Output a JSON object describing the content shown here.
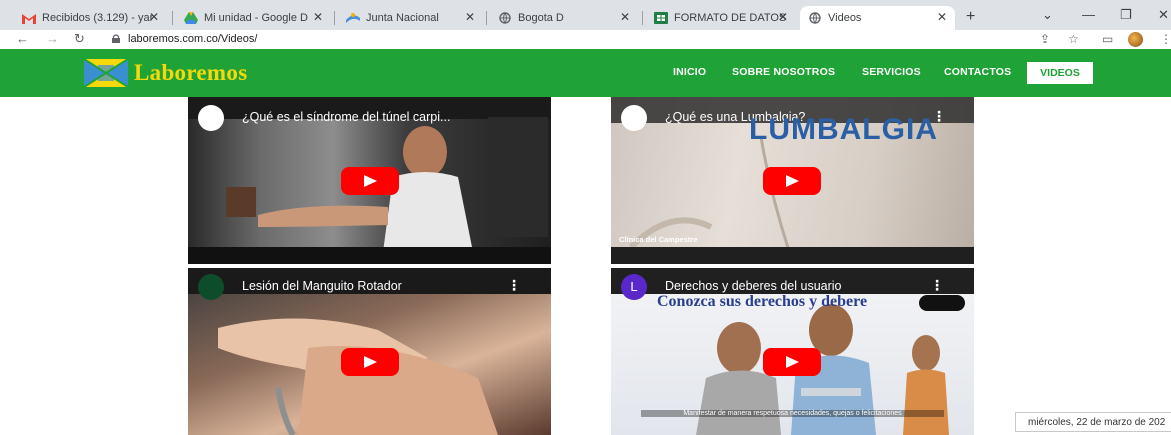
{
  "browser": {
    "tabs": [
      {
        "title": "Recibidos (3.129) - yar",
        "icon": "gmail-icon"
      },
      {
        "title": "Mi unidad - Google D",
        "icon": "drive-icon"
      },
      {
        "title": "Junta Nacional",
        "icon": "site-icon"
      },
      {
        "title": "Bogota D",
        "icon": "globe-icon"
      },
      {
        "title": "FORMATO DE DATOS",
        "icon": "sheets-icon"
      },
      {
        "title": "Videos",
        "icon": "globe-icon"
      }
    ],
    "url": "laboremos.com.co/Videos/"
  },
  "site": {
    "logo_text": "Laboremos",
    "nav": {
      "inicio": "INICIO",
      "sobre": "SOBRE NOSOTROS",
      "servicios": "SERVICIOS",
      "contactos": "CONTACTOS",
      "videos": "VIDEOS"
    },
    "colors": {
      "header": "#1fa336",
      "logo": "#f5d90a",
      "play": "#ff0000"
    }
  },
  "videos": [
    {
      "title": "¿Qué es el síndrome del túnel carpi..."
    },
    {
      "title": "¿Qué es una Lumbalgia?",
      "overlay": "LUMBALGIA",
      "caption": "Clínica del Campestre"
    },
    {
      "title": "Lesión del Manguito Rotador"
    },
    {
      "title": "Derechos y deberes del usuario",
      "overlay": "Conozca sus derechos y debere",
      "caption": "Manifestar de manera respetuosa necesidades, quejas o felicitaciones",
      "channel_letter": "L"
    }
  ],
  "tooltip": {
    "date": "miércoles, 22 de marzo de 202"
  }
}
